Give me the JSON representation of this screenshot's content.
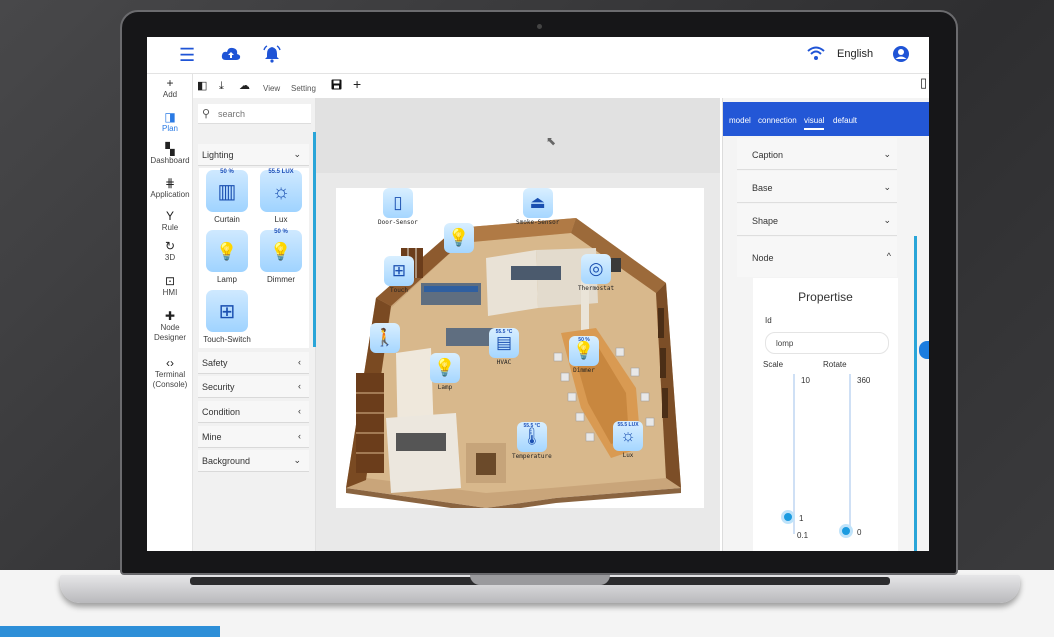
{
  "topbar": {
    "menu_icon": "menu-icon",
    "cloud_icon": "cloud-upload-icon",
    "bell_icon": "bell-icon",
    "wifi_icon": "wifi-icon",
    "language": "English",
    "account_icon": "account-icon"
  },
  "nav": [
    {
      "label": "Add",
      "icon": "plus-icon",
      "glyph": "+"
    },
    {
      "label": "Plan",
      "icon": "plan-icon",
      "glyph": "◨",
      "active": true
    },
    {
      "label": "Dashboard",
      "icon": "dashboard-icon",
      "glyph": "▚"
    },
    {
      "label": "Application",
      "icon": "application-icon",
      "glyph": "⋕"
    },
    {
      "label": "Rule",
      "icon": "rule-icon",
      "glyph": "Y"
    },
    {
      "label": "3D",
      "icon": "rotate-3d-icon",
      "glyph": "↻"
    },
    {
      "label": "HMI",
      "icon": "hmi-icon",
      "glyph": "⊡"
    },
    {
      "label": "Node Designer",
      "icon": "puzzle-icon",
      "glyph": "✚"
    },
    {
      "label": "Terminal (Console)",
      "icon": "code-icon",
      "glyph": "‹›"
    }
  ],
  "toolbar": {
    "view_label": "View",
    "setting_label": "Setting",
    "add_glyph": "+"
  },
  "palette": {
    "search_placeholder": "search",
    "lighting": "Lighting",
    "safety": "Safety",
    "security": "Security",
    "condition": "Condition",
    "mine": "Mine",
    "background": "Background",
    "tiles": [
      {
        "label": "Curtain",
        "value": "50 %",
        "glyph": "▥"
      },
      {
        "label": "Lux",
        "value": "55.5  LUX",
        "glyph": "☼"
      },
      {
        "label": "Lamp",
        "value": "",
        "glyph": "💡"
      },
      {
        "label": "Dimmer",
        "value": "50 %",
        "glyph": "💡"
      },
      {
        "label": "Touch-Switch",
        "value": "",
        "glyph": "⊞"
      }
    ]
  },
  "canvas": {
    "devices": [
      {
        "label": "Door-Sensor",
        "value": "",
        "glyph": "▯"
      },
      {
        "label": "",
        "value": "",
        "glyph": "💡"
      },
      {
        "label": "Smoke-Sensor",
        "value": "",
        "glyph": "⏏"
      },
      {
        "label": "Touch",
        "value": "",
        "glyph": "⊞"
      },
      {
        "label": "Thermostat",
        "value": "",
        "glyph": "◎"
      },
      {
        "label": "",
        "value": "",
        "glyph": "🚶"
      },
      {
        "label": "HVAC",
        "value": "55.5 °C",
        "glyph": "▤"
      },
      {
        "label": "Dimmer",
        "value": "50 %",
        "glyph": "💡"
      },
      {
        "label": "Lamp",
        "value": "",
        "glyph": "💡"
      },
      {
        "label": "Temperature",
        "value": "55.5 °C",
        "glyph": "🌡"
      },
      {
        "label": "Lux",
        "value": "55.5  LUX",
        "glyph": "☼"
      }
    ]
  },
  "rpanel": {
    "tabs": [
      "model",
      "connection",
      "visual",
      "default"
    ],
    "active_tab": "visual",
    "sections": [
      "Caption",
      "Base",
      "Shape",
      "Node"
    ],
    "props_title": "Propertise",
    "id_label": "Id",
    "id_value": "lomp",
    "scale_label": "Scale",
    "rotate_label": "Rotate",
    "scale_max": "10",
    "scale_value": "1",
    "scale_min": "0.1",
    "rotate_max": "360",
    "rotate_value": "0"
  }
}
